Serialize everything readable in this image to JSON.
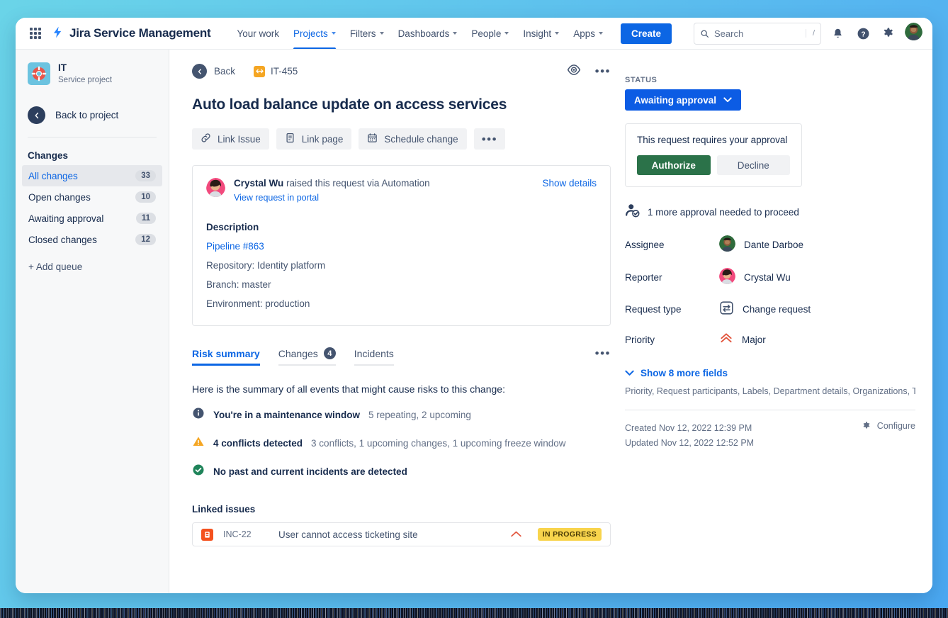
{
  "topnav": {
    "apps_grid_icon": "grid-icon",
    "brand": "Jira Service Management",
    "items": [
      {
        "label": "Your work",
        "has_caret": false,
        "active": false
      },
      {
        "label": "Projects",
        "has_caret": true,
        "active": true
      },
      {
        "label": "Filters",
        "has_caret": true,
        "active": false
      },
      {
        "label": "Dashboards",
        "has_caret": true,
        "active": false
      },
      {
        "label": "People",
        "has_caret": true,
        "active": false
      },
      {
        "label": "Insight",
        "has_caret": true,
        "active": false
      },
      {
        "label": "Apps",
        "has_caret": true,
        "active": false
      }
    ],
    "create_label": "Create",
    "search_placeholder": "Search",
    "search_shortcut": "/",
    "icons": [
      "notifications-bell-icon",
      "help-icon",
      "settings-gear-icon",
      "user-avatar"
    ],
    "accent_blue": "#0c66e4"
  },
  "sidebar": {
    "project_name": "IT",
    "project_type": "Service project",
    "back_to_project": "Back to project",
    "section_title": "Changes",
    "queues": [
      {
        "label": "All changes",
        "count": "33",
        "active": true
      },
      {
        "label": "Open changes",
        "count": "10",
        "active": false
      },
      {
        "label": "Awaiting approval",
        "count": "11",
        "active": false
      },
      {
        "label": "Closed changes",
        "count": "12",
        "active": false
      }
    ],
    "add_queue": "+ Add queue"
  },
  "issue": {
    "back_label": "Back",
    "key": "IT-455",
    "title": "Auto load balance update on access services",
    "toolbar": [
      {
        "label": "Link Issue",
        "icon": "link-icon"
      },
      {
        "label": "Link page",
        "icon": "page-icon"
      },
      {
        "label": "Schedule change",
        "icon": "calendar-icon"
      }
    ],
    "watch_icon": "eye-watch-icon",
    "more_icon": "more-actions-icon"
  },
  "request_card": {
    "reporter_name": "Crystal Wu",
    "raised_text": "raised this request via Automation",
    "portal_link": "View request in portal",
    "show_details": "Show details",
    "description_title": "Description",
    "description_link": "Pipeline #863",
    "description_lines": [
      "Repository: Identity platform",
      "Branch: master",
      "Environment: production"
    ]
  },
  "tabs": [
    {
      "label": "Risk summary",
      "badge": null,
      "active": true
    },
    {
      "label": "Changes",
      "badge": "4",
      "active": false
    },
    {
      "label": "Incidents",
      "badge": null,
      "active": false
    }
  ],
  "risk": {
    "intro": "Here is the summary of all events that might cause risks to this change:",
    "rows": [
      {
        "icon": "info-icon",
        "icon_color": "#44546f",
        "strong": "You're in a maintenance window",
        "sub": "5 repeating, 2 upcoming"
      },
      {
        "icon": "warning-icon",
        "icon_color": "#f5a623",
        "strong": "4 conflicts detected",
        "sub": "3 conflicts, 1 upcoming changes, 1 upcoming freeze window"
      },
      {
        "icon": "success-check-icon",
        "icon_color": "#1f845a",
        "strong": "No past and current incidents are detected",
        "sub": ""
      }
    ]
  },
  "linked_issues": {
    "title": "Linked issues",
    "rows": [
      {
        "key": "INC-22",
        "summary": "User cannot access ticketing site",
        "status": "IN PROGRESS",
        "status_color": "#f8d44c",
        "type_icon": "incident-icon"
      }
    ]
  },
  "panel": {
    "status_label": "STATUS",
    "status_value": "Awaiting approval",
    "status_color": "#0c5ce4",
    "approval": {
      "prompt": "This request requires your approval",
      "authorize_label": "Authorize",
      "authorize_color": "#2b7249",
      "decline_label": "Decline"
    },
    "approval_needed": "1 more approval needed to proceed",
    "fields": [
      {
        "label": "Assignee",
        "value": "Dante Darboe",
        "icon": "avatar-dante"
      },
      {
        "label": "Reporter",
        "value": "Crystal Wu",
        "icon": "avatar-crystal"
      },
      {
        "label": "Request type",
        "value": "Change request",
        "icon": "change-request-icon"
      },
      {
        "label": "Priority",
        "value": "Major",
        "icon": "priority-major-icon"
      }
    ],
    "show_more_label": "Show 8 more fields",
    "more_fields_list": "Priority, Request participants, Labels, Department details, Organizations, T...",
    "created": "Created Nov 12, 2022 12:39 PM",
    "updated": "Updated Nov 12, 2022 12:52 PM",
    "configure_label": "Configure"
  }
}
